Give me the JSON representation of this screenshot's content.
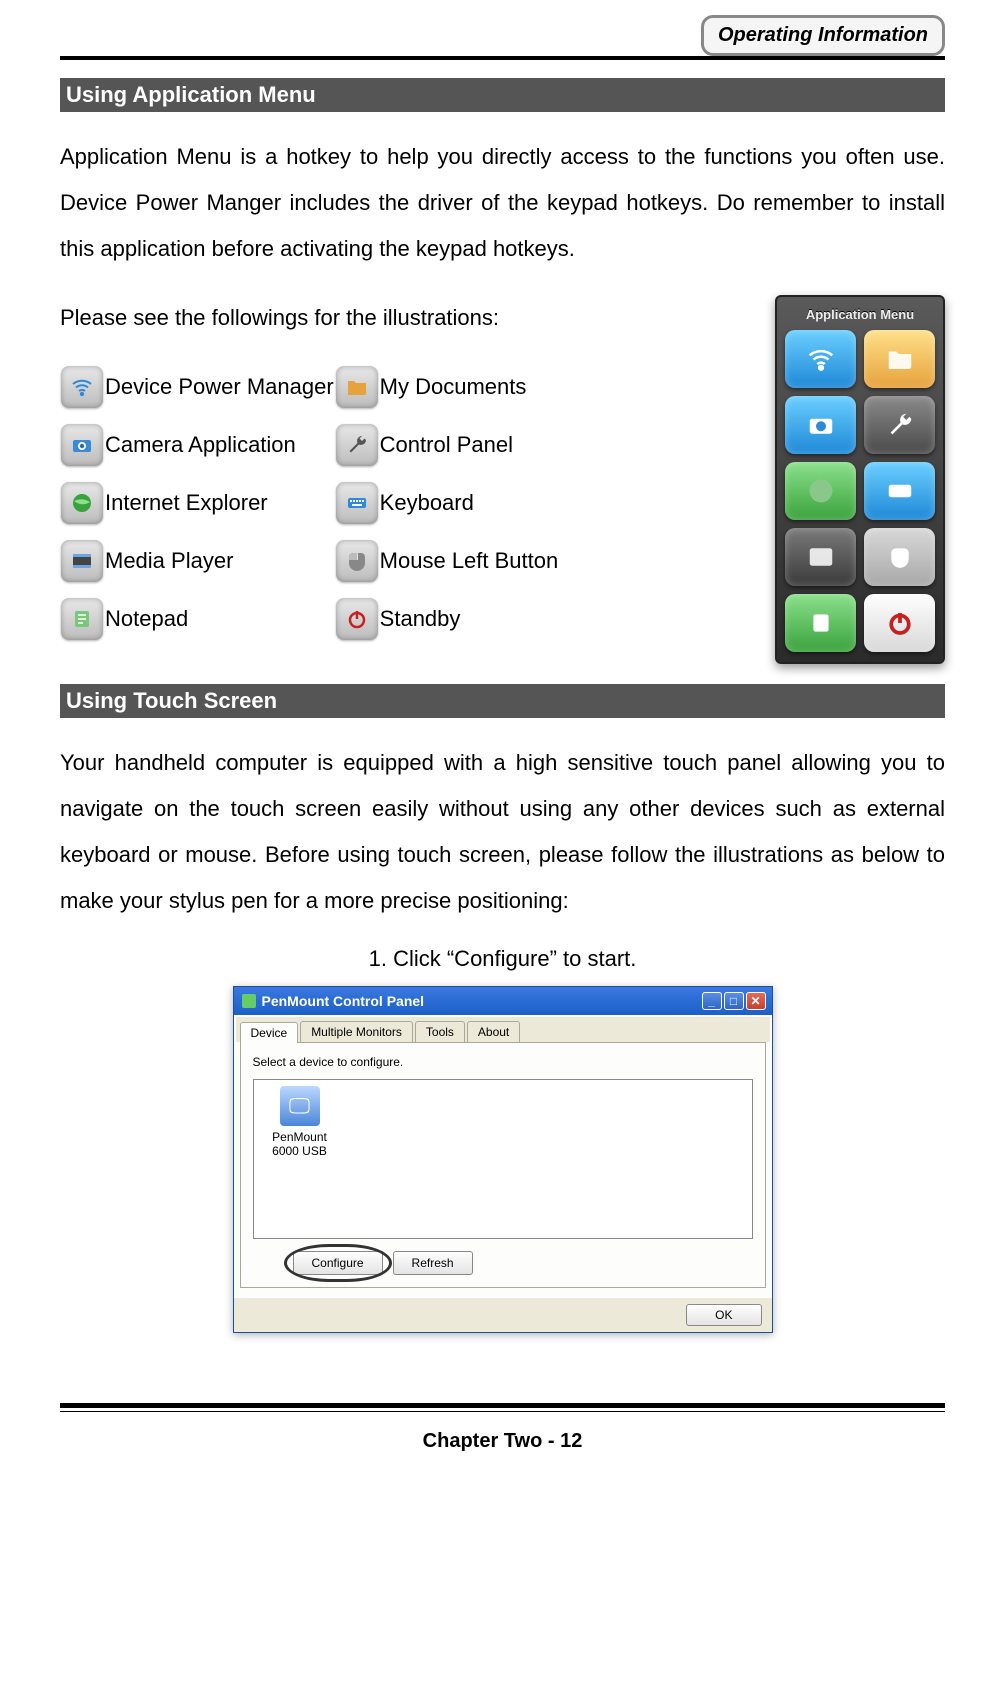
{
  "header": {
    "badge": "Operating Information"
  },
  "sections": {
    "appMenu": {
      "title": " Using Application Menu",
      "paragraph": "Application Menu is a hotkey to help you directly access to the functions you often use. Device Power Manger includes the driver of the keypad hotkeys.   Do remember to install this application before activating the keypad hotkeys.",
      "lead": "Please see the followings for the illustrations:",
      "icons": {
        "r1c1": "Device Power Manager",
        "r1c2": "My Documents",
        "r2c1": "Camera Application",
        "r2c2": "Control Panel",
        "r3c1": "Internet Explorer",
        "r3c2": "Keyboard",
        "r4c1": "Media Player",
        "r4c2": "Mouse Left Button",
        "r5c1": "Notepad",
        "r5c2": "Standby"
      },
      "panelTitle": "Application Menu"
    },
    "touch": {
      "title": " Using Touch Screen",
      "paragraph": "Your handheld computer is equipped with a high sensitive touch panel allowing you to navigate on the touch screen easily without using any other devices such as external keyboard or mouse. Before using touch screen, please follow the illustrations as below to make your stylus pen for a more precise positioning:",
      "step1": "1. Click “Configure” to start."
    }
  },
  "dialog": {
    "title": "PenMount Control Panel",
    "tabs": [
      "Device",
      "Multiple Monitors",
      "Tools",
      "About"
    ],
    "hint": "Select a device to configure.",
    "device": "PenMount 6000 USB",
    "buttons": {
      "configure": "Configure",
      "refresh": "Refresh",
      "ok": "OK"
    }
  },
  "footer": {
    "text": "Chapter Two - 12"
  }
}
